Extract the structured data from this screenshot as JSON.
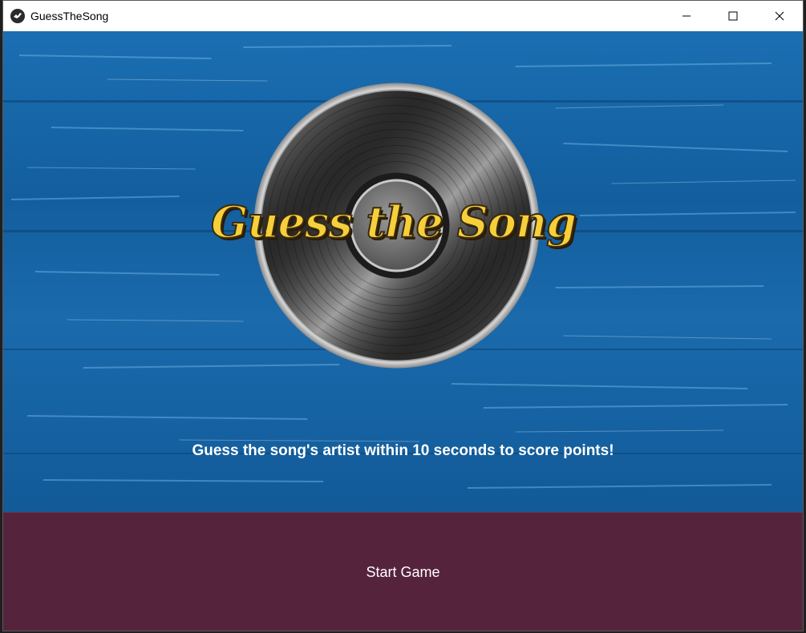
{
  "window": {
    "title": "GuessTheSong",
    "icon": "app-bird-icon",
    "controls": [
      "minimize-icon",
      "maximize-icon",
      "close-icon"
    ]
  },
  "hero": {
    "logo_text": "Guess the Song",
    "logo_image": "vinyl-record",
    "tagline": "Guess the song's artist within 10 seconds to score points!"
  },
  "actions": {
    "start_label": "Start Game"
  },
  "colors": {
    "background": "#1566a8",
    "button": "#56233d",
    "logo_text": "#f6cf3a"
  }
}
